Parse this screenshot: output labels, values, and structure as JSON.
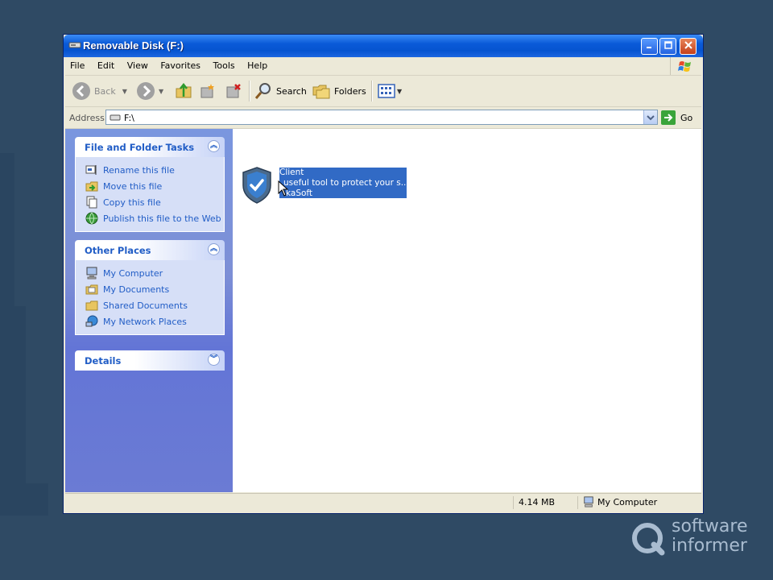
{
  "window": {
    "title": "Removable Disk (F:)"
  },
  "menu": [
    "File",
    "Edit",
    "View",
    "Favorites",
    "Tools",
    "Help"
  ],
  "toolbar": {
    "back_label": "Back",
    "search_label": "Search",
    "folders_label": "Folders"
  },
  "address": {
    "label": "Address",
    "value": "F:\\",
    "go_label": "Go"
  },
  "panels": {
    "file_tasks": {
      "title": "File and Folder Tasks",
      "items": [
        "Rename this file",
        "Move this file",
        "Copy this file",
        "Publish this file to the Web"
      ]
    },
    "other_places": {
      "title": "Other Places",
      "items": [
        "My Computer",
        "My Documents",
        "Shared Documents",
        "My Network Places"
      ]
    },
    "details": {
      "title": "Details"
    }
  },
  "file": {
    "line1": "Client",
    "line2": "useful tool to protect your s...",
    "line3": "kaSoft"
  },
  "status": {
    "size": "4.14 MB",
    "zone": "My Computer"
  },
  "watermark": {
    "line1": "software",
    "line2": "informer"
  },
  "colors": {
    "titlebar": "#0a5ad8",
    "link": "#215dc6",
    "selection": "#316ac5"
  }
}
